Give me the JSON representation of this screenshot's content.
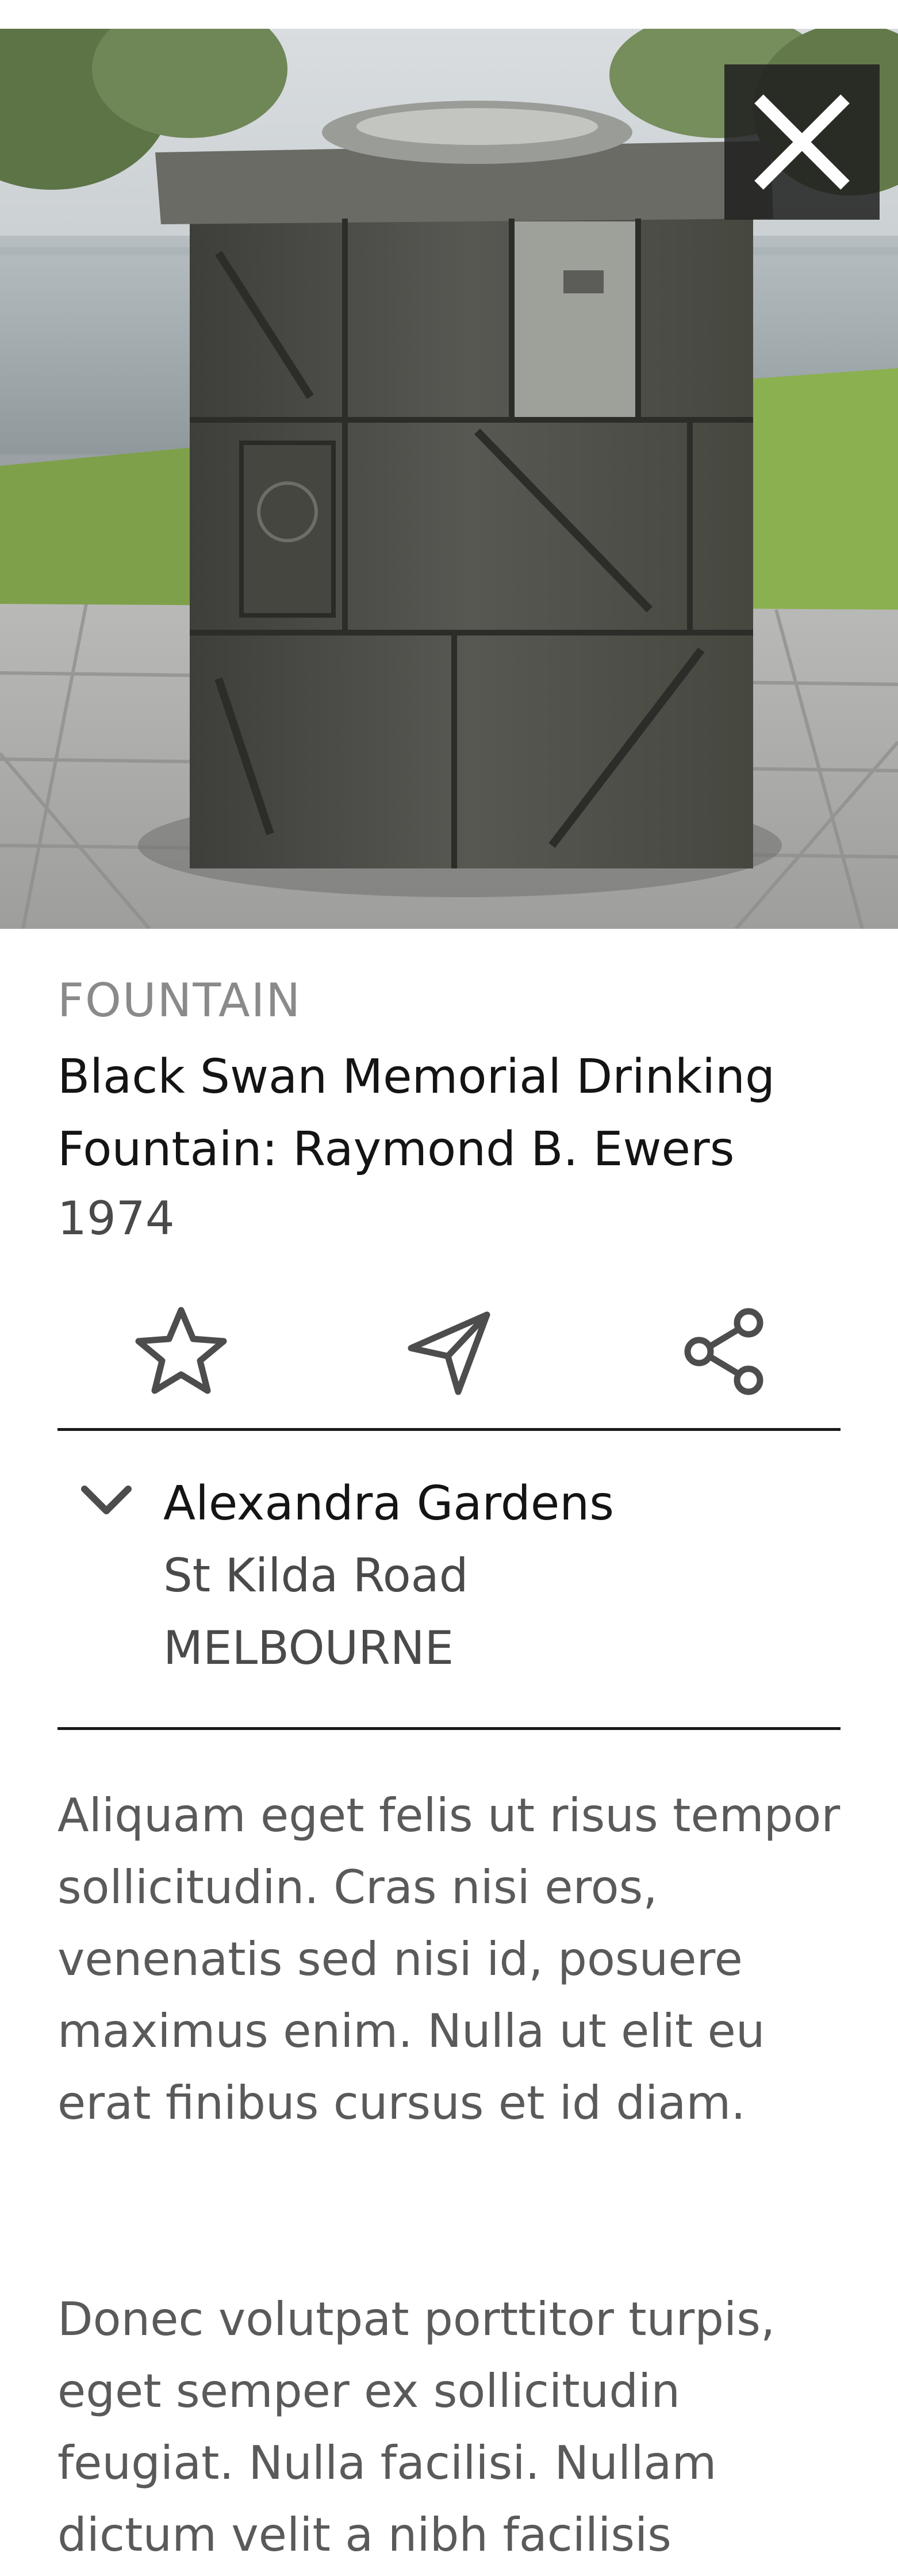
{
  "detail": {
    "category": "FOUNTAIN",
    "title": "Black Swan Memorial  Drinking Fountain: Raymond B. Ewers",
    "year": "1974"
  },
  "actions": {
    "favourite_icon": "star-outline-icon",
    "directions_icon": "navigation-arrow-icon",
    "share_icon": "share-icon",
    "close_icon": "close-x-icon"
  },
  "location": {
    "name": "Alexandra Gardens",
    "street": "St Kilda Road",
    "city": "MELBOURNE",
    "toggle_icon": "chevron-down-icon"
  },
  "description": {
    "paragraph_1": "Aliquam eget felis ut risus tempor sollicitudin. Cras nisi eros, venenatis sed nisi id, posuere maximus enim. Nulla ut elit eu erat finibus cursus et id diam.",
    "paragraph_2": "Donec volutpat porttitor turpis, eget semper ex sollicitudin feugiat. Nulla facilisi. Nullam dictum velit a nibh facilisis"
  },
  "colors": {
    "heading_text": "#141414",
    "secondary_text": "#4a4a4a",
    "muted_text": "#8a8a8a",
    "divider": "#1a1a1a",
    "icon_stroke": "#4d4d4d"
  }
}
